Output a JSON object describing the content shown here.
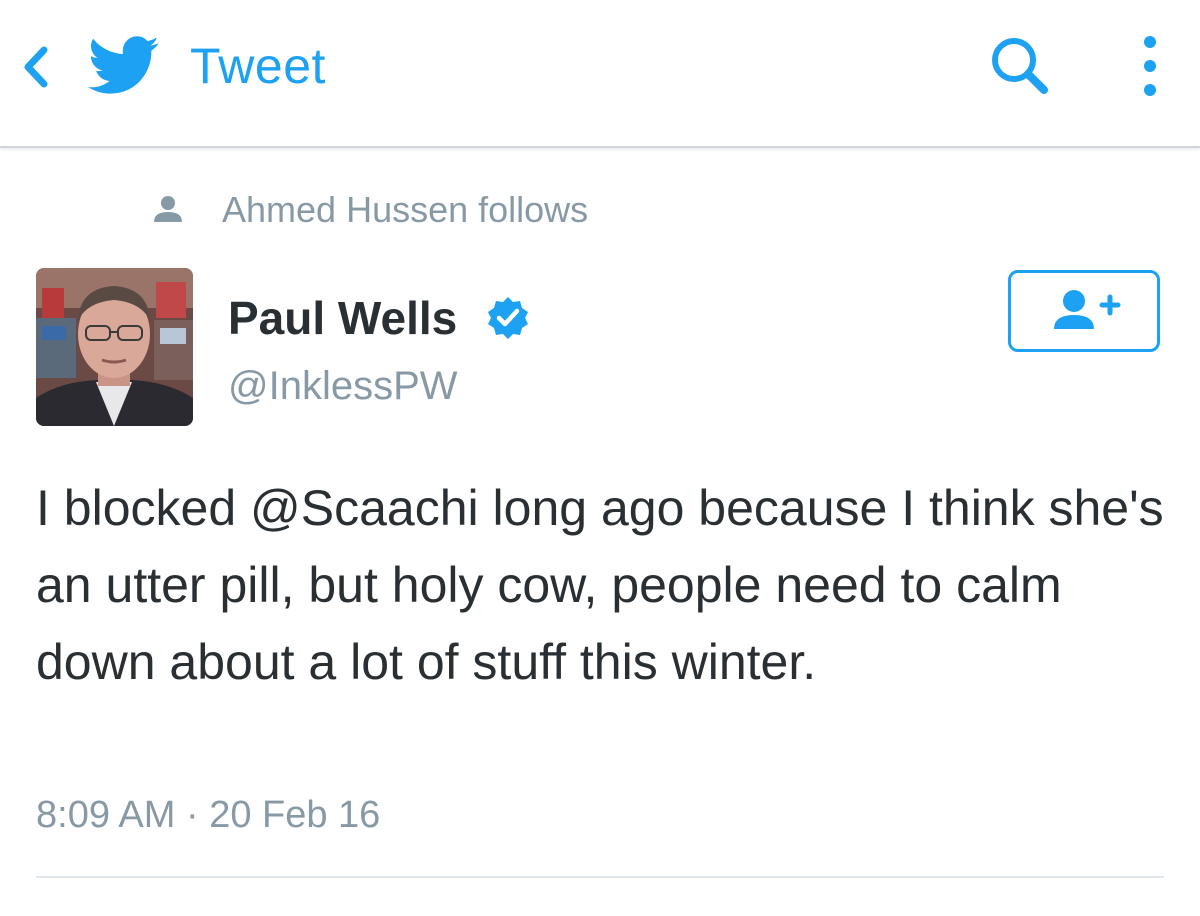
{
  "header": {
    "back_icon": "chevron-left-icon",
    "logo_icon": "twitter-bird-icon",
    "title": "Tweet",
    "search_icon": "search-icon",
    "more_icon": "vertical-dots-icon"
  },
  "context": {
    "icon": "person-icon",
    "text": "Ahmed Hussen follows"
  },
  "author": {
    "name": "Paul Wells",
    "verified_icon": "verified-badge-icon",
    "handle": "@InklessPW",
    "follow_icon": "follow-user-icon"
  },
  "tweet": {
    "text": "I blocked @Scaachi long ago because I think she's an utter pill, but holy cow, people need to calm down about a lot of stuff this winter.",
    "timestamp": "8:09 AM · 20 Feb 16"
  },
  "colors": {
    "accent": "#1da1f2",
    "text_primary": "#292f33",
    "text_secondary": "#8899a6",
    "divider": "#e1e8ed"
  }
}
